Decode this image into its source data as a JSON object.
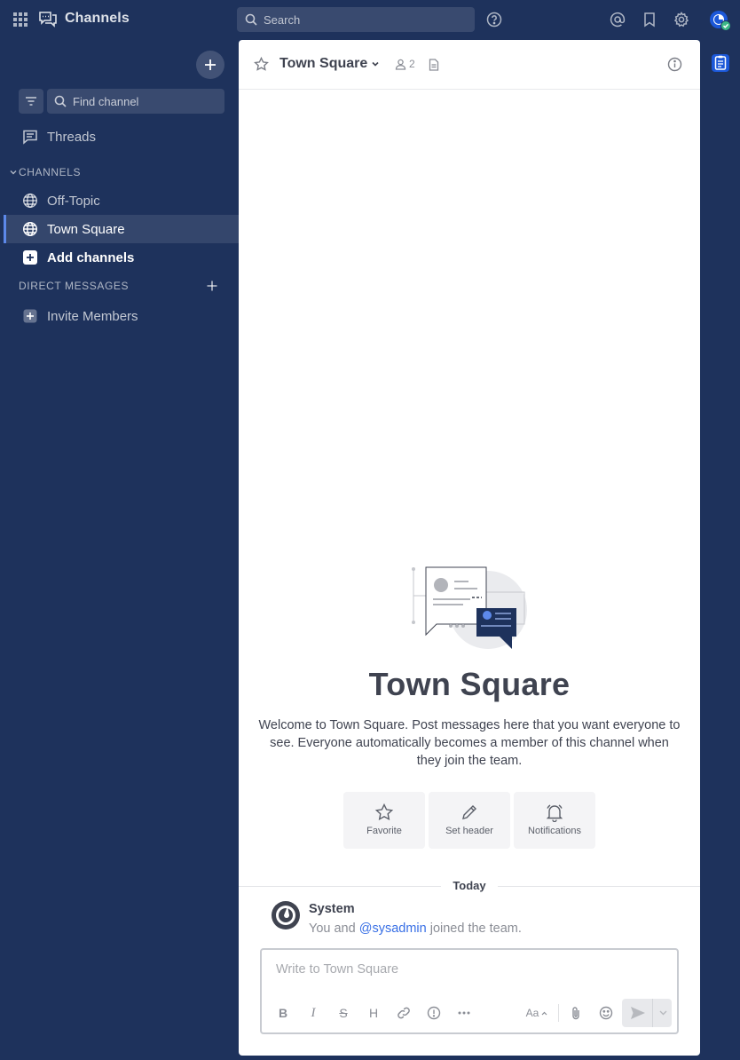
{
  "topbar": {
    "product_name": "Channels",
    "search_placeholder": "Search",
    "icons": [
      "apps-grid-icon",
      "channels-product-icon",
      "search-icon",
      "help-icon",
      "mentions-icon",
      "saved-icon",
      "settings-icon",
      "user-avatar"
    ]
  },
  "sidebar": {
    "find_channel_placeholder": "Find channel",
    "threads_label": "Threads",
    "channels_heading": "CHANNELS",
    "channels": [
      {
        "label": "Off-Topic",
        "active": false
      },
      {
        "label": "Town Square",
        "active": true
      }
    ],
    "add_channels_label": "Add channels",
    "dm_heading": "DIRECT MESSAGES",
    "invite_label": "Invite Members"
  },
  "channel": {
    "name": "Town Square",
    "member_count": "2",
    "intro_title": "Town Square",
    "intro_description": "Welcome to Town Square. Post messages here that you want everyone to see. Everyone automatically becomes a member of this channel when they join the team.",
    "actions": [
      {
        "label": "Favorite",
        "icon": "star-icon"
      },
      {
        "label": "Set header",
        "icon": "pencil-icon"
      },
      {
        "label": "Notifications",
        "icon": "bell-icon"
      }
    ]
  },
  "post": {
    "date_separator": "Today",
    "author": "System",
    "message_prefix": "You and ",
    "mention": "@sysadmin",
    "message_suffix": " joined the team."
  },
  "composer": {
    "placeholder": "Write to Town Square",
    "format_toggle_label": "Aa"
  },
  "colors": {
    "sidebar_bg": "#1e325c",
    "accent": "#386fe5",
    "active_border": "#5d89ea",
    "online": "#3db887"
  }
}
